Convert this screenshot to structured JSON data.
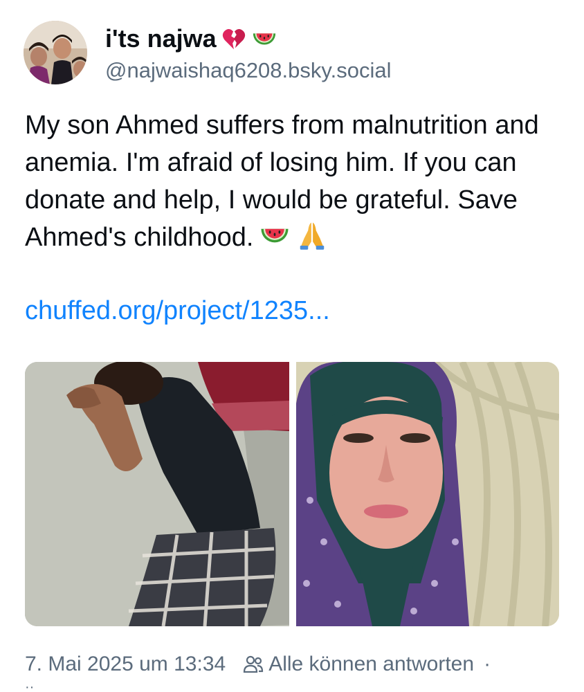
{
  "author": {
    "display_name": "i'ts najwa",
    "name_emojis": [
      "broken-heart-emoji",
      "watermelon-emoji"
    ],
    "handle": "@najwaishaq6208.bsky.social",
    "avatar_icon": "avatar-photo"
  },
  "post": {
    "text": "My son Ahmed suffers from malnutrition and anemia. I'm afraid of losing him. If you can donate and help, I would be grateful. Save Ahmed's childhood.",
    "text_emojis": [
      "watermelon-emoji",
      "folded-hands-emoji"
    ],
    "link_text": "chuffed.org/project/1235...",
    "images": [
      {
        "name": "child-sleeping-photo"
      },
      {
        "name": "woman-hijab-selfie-photo"
      }
    ]
  },
  "footer": {
    "timestamp": "7. Mai 2025 um 13:34",
    "reply_setting_icon": "people-icon",
    "reply_setting": "Alle können antworten",
    "separator": "·",
    "trailing": "··"
  },
  "colors": {
    "link": "#1083fe",
    "text": "#0b0f14",
    "muted": "#5b6b7c",
    "background": "#ffffff"
  }
}
